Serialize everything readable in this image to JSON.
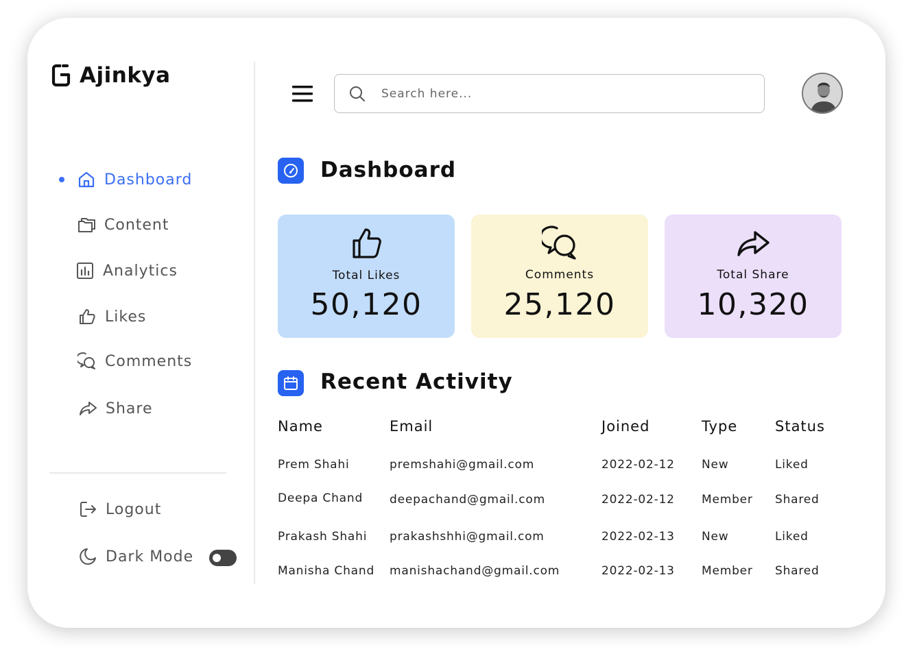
{
  "brand": {
    "name": "Ajinkya",
    "logo_icon": "brand-logo-icon"
  },
  "sidebar": {
    "items": [
      {
        "label": "Dashboard",
        "icon": "home-icon",
        "active": true
      },
      {
        "label": "Content",
        "icon": "folders-icon"
      },
      {
        "label": "Analytics",
        "icon": "bar-chart-icon"
      },
      {
        "label": "Likes",
        "icon": "thumbs-up-icon"
      },
      {
        "label": "Comments",
        "icon": "comments-icon"
      },
      {
        "label": "Share",
        "icon": "share-icon"
      }
    ],
    "logout_label": "Logout",
    "dark_mode_label": "Dark Mode"
  },
  "header": {
    "search_placeholder": "Search here...",
    "search_value": ""
  },
  "dashboard": {
    "title": "Dashboard",
    "cards": [
      {
        "label": "Total Likes",
        "value": "50,120",
        "color": "#c2ddfb",
        "icon": "thumbs-up-icon"
      },
      {
        "label": "Comments",
        "value": "25,120",
        "color": "#fbf4d5",
        "icon": "comments-icon"
      },
      {
        "label": "Total Share",
        "value": "10,320",
        "color": "#ecdffa",
        "icon": "share-icon"
      }
    ]
  },
  "recent_activity": {
    "title": "Recent Activity",
    "columns": [
      "Name",
      "Email",
      "Joined",
      "Type",
      "Status"
    ],
    "rows": [
      [
        "Prem Shahi",
        "premshahi@gmail.com",
        "2022-02-12",
        "New",
        "Liked"
      ],
      [
        "Deepa Chand",
        "deepachand@gmail.com",
        "2022-02-12",
        "Member",
        "Shared"
      ],
      [
        "Prakash Shahi",
        "prakashshhi@gmail.com",
        "2022-02-13",
        "New",
        "Liked"
      ],
      [
        "Manisha Chand",
        "manishachand@gmail.com",
        "2022-02-13",
        "Member",
        "Shared"
      ]
    ]
  },
  "colors": {
    "accent": "#3b6ef5",
    "section_icon_bg": "#2762f1"
  }
}
